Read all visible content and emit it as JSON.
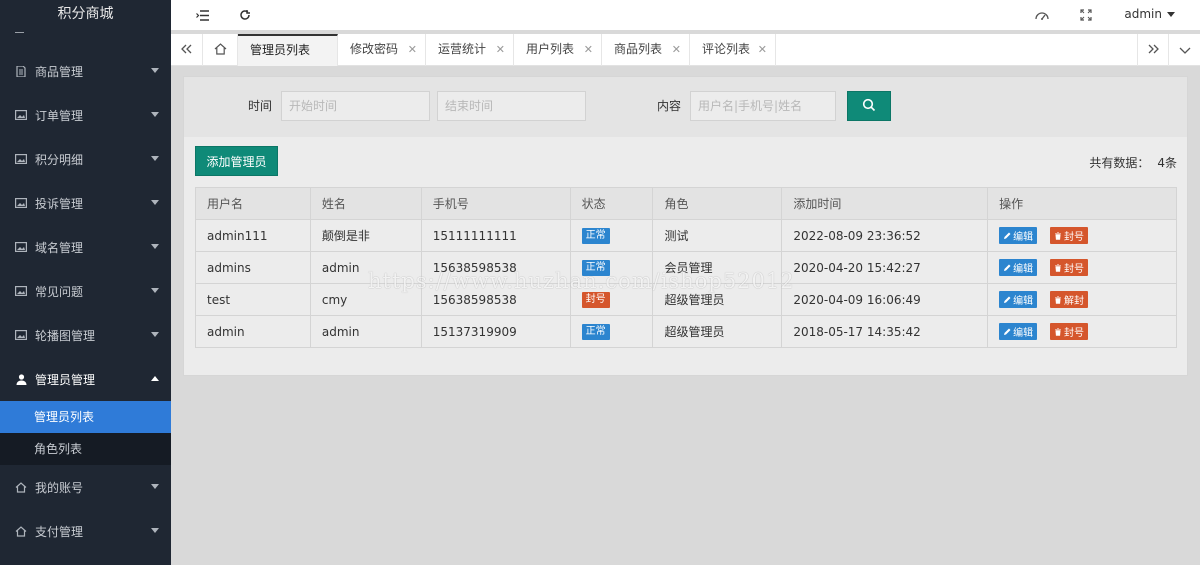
{
  "sidebar": {
    "logo": "积分商城",
    "items": [
      {
        "label": "商品管理",
        "icon": "document-icon"
      },
      {
        "label": "订单管理",
        "icon": "image-icon"
      },
      {
        "label": "积分明细",
        "icon": "image-icon"
      },
      {
        "label": "投诉管理",
        "icon": "image-icon"
      },
      {
        "label": "域名管理",
        "icon": "image-icon"
      },
      {
        "label": "常见问题",
        "icon": "image-icon"
      },
      {
        "label": "轮播图管理",
        "icon": "image-icon"
      },
      {
        "label": "管理员管理",
        "icon": "user-icon",
        "open": true
      },
      {
        "label": "我的账号",
        "icon": "home-icon"
      },
      {
        "label": "支付管理",
        "icon": "home-icon"
      }
    ],
    "sub_items": [
      "管理员列表",
      "角色列表"
    ]
  },
  "header": {
    "user": "admin"
  },
  "tabs": [
    "管理员列表",
    "修改密码",
    "运营统计",
    "用户列表",
    "商品列表",
    "评论列表"
  ],
  "filter": {
    "time_label": "时间",
    "start_placeholder": "开始时间",
    "end_placeholder": "结束时间",
    "content_label": "内容",
    "content_placeholder": "用户名|手机号|姓名"
  },
  "toolbar": {
    "add_label": "添加管理员",
    "total_label": "共有数据：",
    "total_value": "4条"
  },
  "table": {
    "columns": [
      "用户名",
      "姓名",
      "手机号",
      "状态",
      "角色",
      "添加时间",
      "操作"
    ],
    "rows": [
      {
        "username": "admin111",
        "name": "颠倒是非",
        "phone": "15111111111",
        "status": "正常",
        "role": "测试",
        "time": "2022-08-09 23:36:52",
        "action": "封号"
      },
      {
        "username": "admins",
        "name": "admin",
        "phone": "15638598538",
        "status": "正常",
        "role": "会员管理",
        "time": "2020-04-20 15:42:27",
        "action": "封号"
      },
      {
        "username": "test",
        "name": "cmy",
        "phone": "15638598538",
        "status": "封号",
        "role": "超级管理员",
        "time": "2020-04-09 16:06:49",
        "action": "解封"
      },
      {
        "username": "admin",
        "name": "admin",
        "phone": "15137319909",
        "status": "正常",
        "role": "超级管理员",
        "time": "2018-05-17 14:35:42",
        "action": "封号"
      }
    ],
    "edit_label": "编辑"
  },
  "watermark": "https://www.huzhan.com/ishop52012",
  "colors": {
    "sidebar_bg": "#1f2733",
    "active_blue": "#2f7bd8",
    "primary_green": "#0f8a78",
    "badge_normal": "#2c85cf",
    "badge_banned": "#d5562c"
  }
}
